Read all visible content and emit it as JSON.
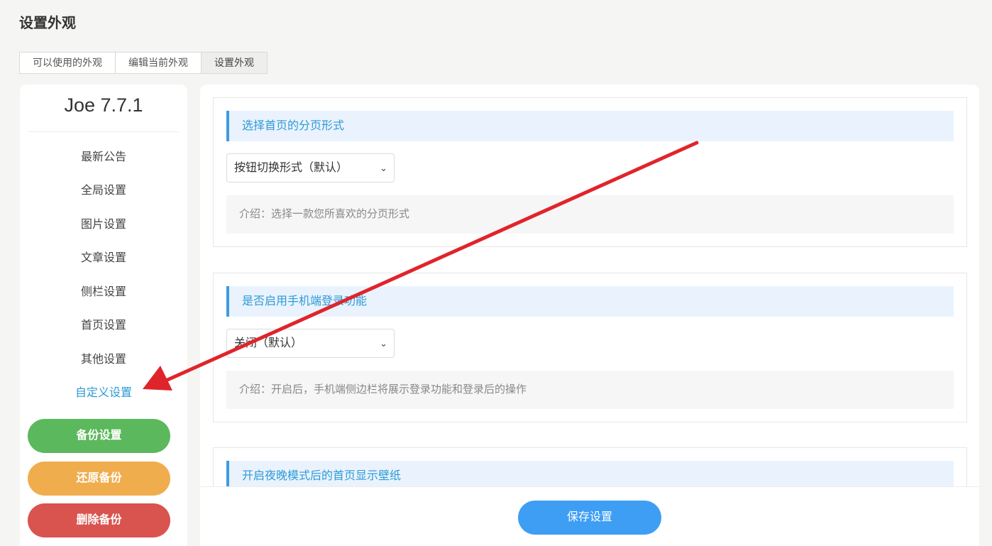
{
  "page": {
    "title": "设置外观"
  },
  "tabs": [
    {
      "label": "可以使用的外观"
    },
    {
      "label": "编辑当前外观"
    },
    {
      "label": "设置外观"
    }
  ],
  "sidebar": {
    "version": "Joe 7.7.1",
    "items": [
      {
        "label": "最新公告"
      },
      {
        "label": "全局设置"
      },
      {
        "label": "图片设置"
      },
      {
        "label": "文章设置"
      },
      {
        "label": "侧栏设置"
      },
      {
        "label": "首页设置"
      },
      {
        "label": "其他设置"
      },
      {
        "label": "自定义设置"
      }
    ],
    "active_item": "自定义设置",
    "buttons": {
      "backup": "备份设置",
      "restore": "还原备份",
      "delete": "删除备份"
    }
  },
  "settings": [
    {
      "title": "选择首页的分页形式",
      "value": "按钮切换形式（默认）",
      "description": "介绍：选择一款您所喜欢的分页形式"
    },
    {
      "title": "是否启用手机端登录功能",
      "value": "关闭（默认）",
      "description": "介绍：开启后，手机端侧边栏将展示登录功能和登录后的操作"
    },
    {
      "title": "开启夜晚模式后的首页显示壁纸"
    }
  ],
  "footer": {
    "save_label": "保存设置"
  },
  "colors": {
    "accent": "#2d9ad6",
    "backup": "#5cb85c",
    "restore": "#f0ad4e",
    "delete": "#d9534f",
    "save": "#3e9ef4",
    "annotation_arrow": "#e0242b"
  }
}
